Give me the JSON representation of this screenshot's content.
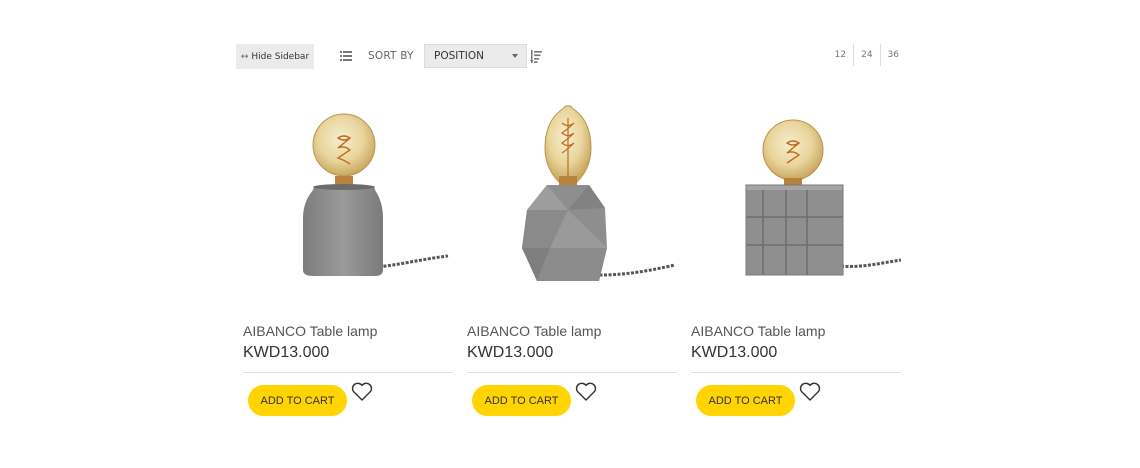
{
  "toolbar": {
    "hide_sidebar_label": "Hide Sidebar",
    "sort_label": "SORT BY",
    "sort_selected": "POSITION",
    "limiter": [
      "12",
      "24",
      "36"
    ]
  },
  "products": [
    {
      "name": "AIBANCO Table lamp",
      "price": "KWD13.000",
      "cart_label": "ADD TO CART"
    },
    {
      "name": "AIBANCO Table lamp",
      "price": "KWD13.000",
      "cart_label": "ADD TO CART"
    },
    {
      "name": "AIBANCO Table lamp",
      "price": "KWD13.000",
      "cart_label": "ADD TO CART"
    }
  ],
  "colors": {
    "accent": "#ffd400",
    "button_bg": "#ebebeb",
    "concrete": "#8d8d8d"
  }
}
